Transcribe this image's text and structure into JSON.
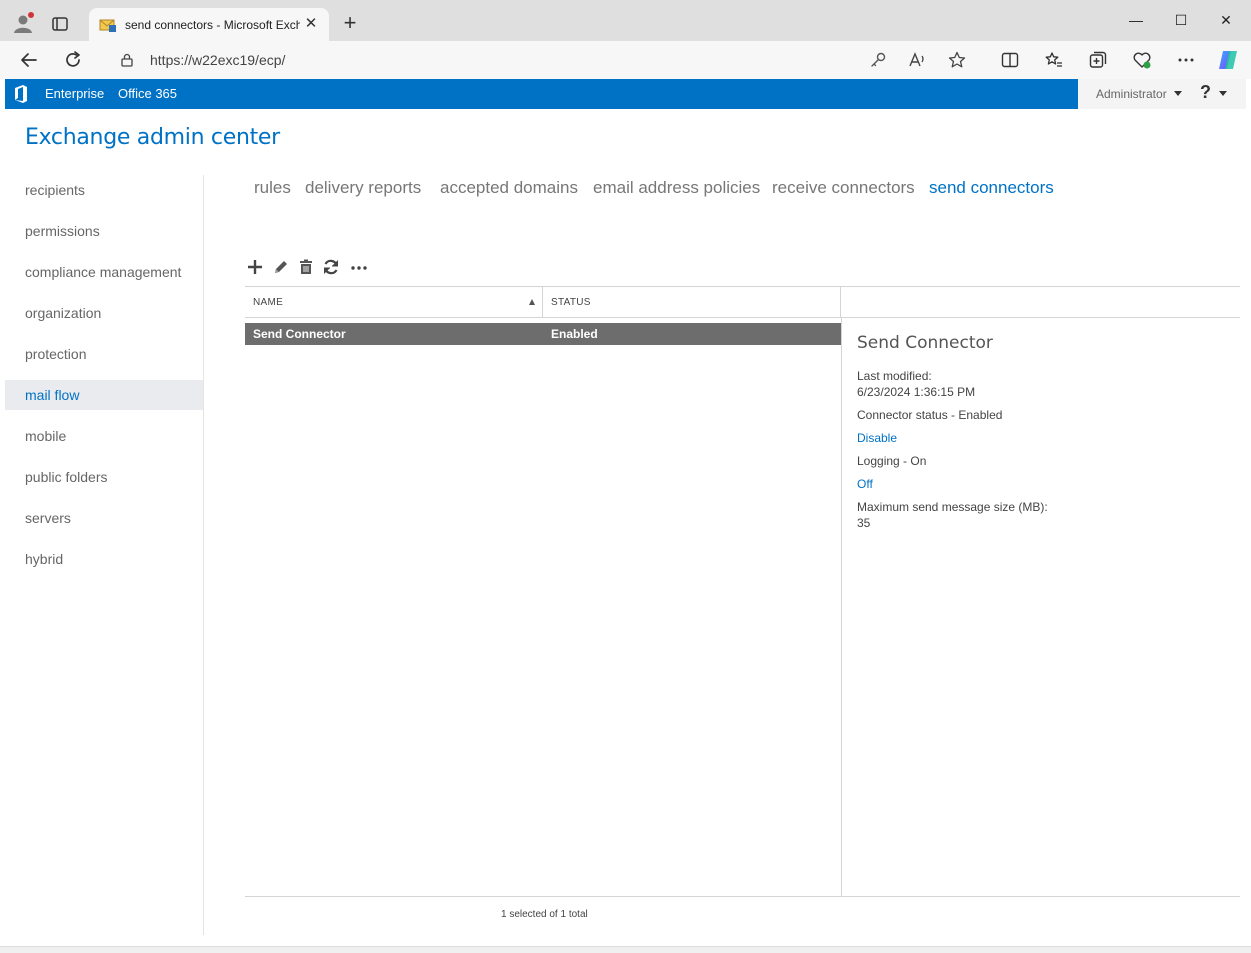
{
  "browser": {
    "tab_title": "send connectors - Microsoft Exchange",
    "url": "https://w22exc19/ecp/",
    "tab_close_glyph": "✕",
    "newtab_glyph": "+",
    "minimize_glyph": "—",
    "maximize_glyph": "☐",
    "close_glyph": "✕"
  },
  "suitebar": {
    "enterprise": "Enterprise",
    "office365": "Office 365",
    "admin": "Administrator",
    "help": "?",
    "color": "#0072c6"
  },
  "app_title": "Exchange admin center",
  "leftnav": {
    "items": [
      {
        "label": "recipients"
      },
      {
        "label": "permissions"
      },
      {
        "label": "compliance management"
      },
      {
        "label": "organization"
      },
      {
        "label": "protection"
      },
      {
        "label": "mail flow",
        "selected": true
      },
      {
        "label": "mobile"
      },
      {
        "label": "public folders"
      },
      {
        "label": "servers"
      },
      {
        "label": "hybrid"
      }
    ]
  },
  "subtabs": [
    {
      "label": "rules"
    },
    {
      "label": "delivery reports"
    },
    {
      "label": "accepted domains"
    },
    {
      "label": "email address policies"
    },
    {
      "label": "receive connectors"
    },
    {
      "label": "send connectors",
      "active": true
    }
  ],
  "toolbar": {
    "icons": [
      "add-icon",
      "edit-icon",
      "delete-icon",
      "refresh-icon",
      "more-icon"
    ]
  },
  "grid": {
    "columns": [
      "NAME",
      "STATUS"
    ],
    "rows": [
      {
        "name": "Send Connector",
        "status": "Enabled",
        "selected": true
      }
    ],
    "footer": "1 selected of 1 total"
  },
  "details": {
    "title": "Send Connector",
    "last_modified_label": "Last modified:",
    "last_modified_value": "6/23/2024 1:36:15 PM",
    "connector_status": "Connector status - Enabled",
    "disable_link": "Disable",
    "logging": "Logging - On",
    "off_link": "Off",
    "max_size_label": "Maximum send message size (MB):",
    "max_size_value": "35"
  }
}
